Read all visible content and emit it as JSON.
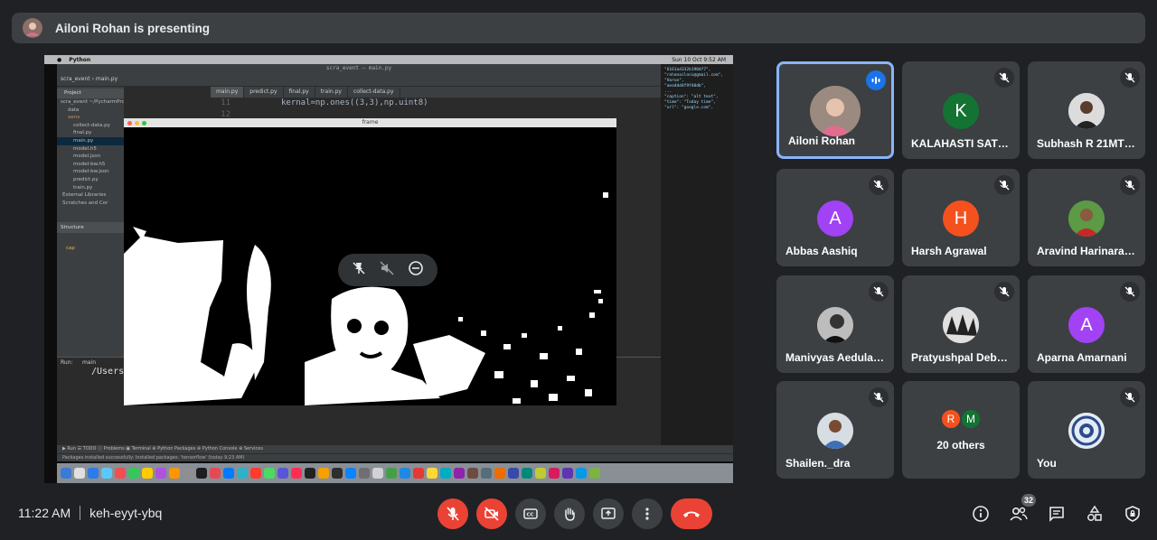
{
  "banner": {
    "title": "Ailoni Rohan is presenting"
  },
  "shared_screen": {
    "mac_app": "Python",
    "mac_clock": "Sun 10 Oct  9:52 AM",
    "ide_title": "scra_event – main.py",
    "breadcrumb": "scra_event  ›  main.py",
    "tabs": [
      "main.py",
      "predict.py",
      "final.py",
      "train.py",
      "collect-data.py"
    ],
    "project_header": "Project",
    "project_rows": [
      "scra_event  ~/PycharmProjects/scra_event",
      "data",
      "venv",
      "collect-data.py",
      "final.py",
      "main.py",
      "model.h5",
      "model.json",
      "model-bw.h5",
      "model-bw.json",
      "predict.py",
      "train.py",
      "External Libraries",
      "Scratches and Cor"
    ],
    "structure_header": "Structure",
    "structure_item": "cap",
    "code_lines": [
      {
        "n": "11",
        "t": "kernal=np.ones((3,3),np.uint8)"
      },
      {
        "n": "12",
        "t": ""
      }
    ],
    "frame_title": "frame",
    "run_label": "Run:",
    "run_tab": "main",
    "run_path": "/Users/",
    "bottom_tabs": "▶ Run    ☰ TODO    ⓘ Problems    ▣ Terminal    ⊕ Python Packages    ⊕ Python Console    ⊕ Services",
    "status_text": "Packages installed successfully: Installed packages: 'tensorflow' (today 9:23 AM)",
    "json_text": "\"6161ad332b1904f7\",\n\"rohanailoni@gmail.com\",\n\"Varun\",\n\"aea4dd4f9f40db\",\n...\n\"caption\": \"alt text\",\n\"time\": \"Today time\",\n\"url\": \"google.com\","
  },
  "participants": [
    {
      "name": "Ailoni Rohan",
      "initial": "",
      "color": "#7d6a63",
      "speaking": true
    },
    {
      "name": "KALAHASTI SATH...",
      "initial": "K",
      "color": "#137333",
      "speaking": false
    },
    {
      "name": "Subhash R 21MTS...",
      "initial": "",
      "color": "#c8c8c8",
      "speaking": false
    },
    {
      "name": "Abbas Aashiq",
      "initial": "A",
      "color": "#a142f4",
      "speaking": false
    },
    {
      "name": "Harsh Agrawal",
      "initial": "H",
      "color": "#f4511e",
      "speaking": false
    },
    {
      "name": "Aravind Harinaray...",
      "initial": "",
      "color": "#4e8a3a",
      "speaking": false
    },
    {
      "name": "Manivyas Aedulap...",
      "initial": "",
      "color": "#999999",
      "speaking": false
    },
    {
      "name": "Pratyushpal Debn...",
      "initial": "",
      "color": "#dddddd",
      "speaking": false
    },
    {
      "name": "Aparna Amarnani",
      "initial": "A",
      "color": "#a142f4",
      "speaking": false
    },
    {
      "name": "Shailen._dra",
      "initial": "",
      "color": "#c0c8d0",
      "speaking": false
    },
    {
      "name": "20 others",
      "initial": "",
      "color": "",
      "speaking": false
    },
    {
      "name": "You",
      "initial": "",
      "color": "#c9d6ea",
      "speaking": false
    }
  ],
  "others": {
    "label": "20 others",
    "a": "R",
    "a_color": "#f4511e",
    "b": "M",
    "b_color": "#137333"
  },
  "meeting": {
    "time": "11:22 AM",
    "code": "keh-eyyt-ybq"
  },
  "people_count": "32",
  "colors": {
    "accent": "#8ab4f8",
    "danger": "#ea4335",
    "tile": "#3c4043",
    "bg": "#202124"
  }
}
